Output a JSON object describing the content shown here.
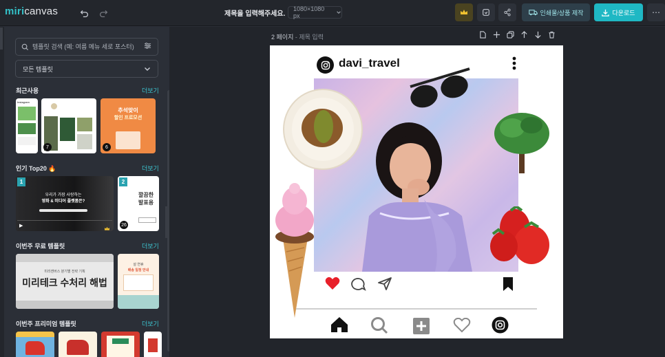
{
  "app": {
    "logo_brand": "miri",
    "logo_product": "canvas",
    "doc_title": "제목을 입력해주세요.",
    "canvas_size": "1080×1080 px",
    "print_label": "인쇄물/상품 제작",
    "download_label": "다운로드"
  },
  "sidebar": {
    "search_placeholder": "템플릿 검색 (예: 여름 메뉴 세로 포스터)",
    "filter_value": "모든 템플릿",
    "more_label": "더보기",
    "sections": [
      {
        "title": "최근사용",
        "badges": [
          "",
          "7",
          "6"
        ]
      },
      {
        "title": "인기 Top20 🔥",
        "ranks": [
          "1",
          "2"
        ],
        "badges": [
          "",
          "26"
        ]
      },
      {
        "title": "이번주 무료 템플릿"
      },
      {
        "title": "이번주 프리미엄 템플릿"
      }
    ],
    "recent_thumb_1_text": "Instagram",
    "recent_thumb_3_line1": "추석맞이",
    "recent_thumb_3_line2": "할인 프로모션",
    "top_thumb_1_line1": "우리가 가장 사랑하는",
    "top_thumb_1_line2": "영화 & 미디어 플랫폼은?",
    "top_thumb_2_line1": "깔끔한",
    "top_thumb_2_line2": "발표용",
    "free_thumb_small": "미리캔버스 분기별 전략 기획",
    "free_thumb_main": "미리테크 수처리 해법",
    "free_thumb_2_line1": "설 연휴",
    "free_thumb_2_line2": "배송 일정 안내"
  },
  "canvas": {
    "page_label": "2 페이지",
    "page_sep": " - ",
    "page_title_placeholder": "제목 입력",
    "ig_username": "davi_travel"
  },
  "colors": {
    "accent": "#1fb8c4",
    "crown": "#f2c230",
    "heart": "#e8202a"
  }
}
